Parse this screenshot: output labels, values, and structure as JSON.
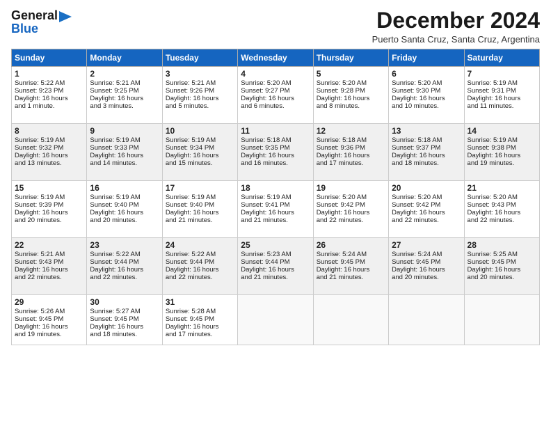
{
  "logo": {
    "line1": "General",
    "line2": "Blue"
  },
  "header": {
    "title": "December 2024",
    "subtitle": "Puerto Santa Cruz, Santa Cruz, Argentina"
  },
  "days_of_week": [
    "Sunday",
    "Monday",
    "Tuesday",
    "Wednesday",
    "Thursday",
    "Friday",
    "Saturday"
  ],
  "weeks": [
    [
      {
        "day": "1",
        "lines": [
          "Sunrise: 5:22 AM",
          "Sunset: 9:23 PM",
          "Daylight: 16 hours",
          "and 1 minute."
        ]
      },
      {
        "day": "2",
        "lines": [
          "Sunrise: 5:21 AM",
          "Sunset: 9:25 PM",
          "Daylight: 16 hours",
          "and 3 minutes."
        ]
      },
      {
        "day": "3",
        "lines": [
          "Sunrise: 5:21 AM",
          "Sunset: 9:26 PM",
          "Daylight: 16 hours",
          "and 5 minutes."
        ]
      },
      {
        "day": "4",
        "lines": [
          "Sunrise: 5:20 AM",
          "Sunset: 9:27 PM",
          "Daylight: 16 hours",
          "and 6 minutes."
        ]
      },
      {
        "day": "5",
        "lines": [
          "Sunrise: 5:20 AM",
          "Sunset: 9:28 PM",
          "Daylight: 16 hours",
          "and 8 minutes."
        ]
      },
      {
        "day": "6",
        "lines": [
          "Sunrise: 5:20 AM",
          "Sunset: 9:30 PM",
          "Daylight: 16 hours",
          "and 10 minutes."
        ]
      },
      {
        "day": "7",
        "lines": [
          "Sunrise: 5:19 AM",
          "Sunset: 9:31 PM",
          "Daylight: 16 hours",
          "and 11 minutes."
        ]
      }
    ],
    [
      {
        "day": "8",
        "lines": [
          "Sunrise: 5:19 AM",
          "Sunset: 9:32 PM",
          "Daylight: 16 hours",
          "and 13 minutes."
        ]
      },
      {
        "day": "9",
        "lines": [
          "Sunrise: 5:19 AM",
          "Sunset: 9:33 PM",
          "Daylight: 16 hours",
          "and 14 minutes."
        ]
      },
      {
        "day": "10",
        "lines": [
          "Sunrise: 5:19 AM",
          "Sunset: 9:34 PM",
          "Daylight: 16 hours",
          "and 15 minutes."
        ]
      },
      {
        "day": "11",
        "lines": [
          "Sunrise: 5:18 AM",
          "Sunset: 9:35 PM",
          "Daylight: 16 hours",
          "and 16 minutes."
        ]
      },
      {
        "day": "12",
        "lines": [
          "Sunrise: 5:18 AM",
          "Sunset: 9:36 PM",
          "Daylight: 16 hours",
          "and 17 minutes."
        ]
      },
      {
        "day": "13",
        "lines": [
          "Sunrise: 5:18 AM",
          "Sunset: 9:37 PM",
          "Daylight: 16 hours",
          "and 18 minutes."
        ]
      },
      {
        "day": "14",
        "lines": [
          "Sunrise: 5:19 AM",
          "Sunset: 9:38 PM",
          "Daylight: 16 hours",
          "and 19 minutes."
        ]
      }
    ],
    [
      {
        "day": "15",
        "lines": [
          "Sunrise: 5:19 AM",
          "Sunset: 9:39 PM",
          "Daylight: 16 hours",
          "and 20 minutes."
        ]
      },
      {
        "day": "16",
        "lines": [
          "Sunrise: 5:19 AM",
          "Sunset: 9:40 PM",
          "Daylight: 16 hours",
          "and 20 minutes."
        ]
      },
      {
        "day": "17",
        "lines": [
          "Sunrise: 5:19 AM",
          "Sunset: 9:40 PM",
          "Daylight: 16 hours",
          "and 21 minutes."
        ]
      },
      {
        "day": "18",
        "lines": [
          "Sunrise: 5:19 AM",
          "Sunset: 9:41 PM",
          "Daylight: 16 hours",
          "and 21 minutes."
        ]
      },
      {
        "day": "19",
        "lines": [
          "Sunrise: 5:20 AM",
          "Sunset: 9:42 PM",
          "Daylight: 16 hours",
          "and 22 minutes."
        ]
      },
      {
        "day": "20",
        "lines": [
          "Sunrise: 5:20 AM",
          "Sunset: 9:42 PM",
          "Daylight: 16 hours",
          "and 22 minutes."
        ]
      },
      {
        "day": "21",
        "lines": [
          "Sunrise: 5:20 AM",
          "Sunset: 9:43 PM",
          "Daylight: 16 hours",
          "and 22 minutes."
        ]
      }
    ],
    [
      {
        "day": "22",
        "lines": [
          "Sunrise: 5:21 AM",
          "Sunset: 9:43 PM",
          "Daylight: 16 hours",
          "and 22 minutes."
        ]
      },
      {
        "day": "23",
        "lines": [
          "Sunrise: 5:22 AM",
          "Sunset: 9:44 PM",
          "Daylight: 16 hours",
          "and 22 minutes."
        ]
      },
      {
        "day": "24",
        "lines": [
          "Sunrise: 5:22 AM",
          "Sunset: 9:44 PM",
          "Daylight: 16 hours",
          "and 22 minutes."
        ]
      },
      {
        "day": "25",
        "lines": [
          "Sunrise: 5:23 AM",
          "Sunset: 9:44 PM",
          "Daylight: 16 hours",
          "and 21 minutes."
        ]
      },
      {
        "day": "26",
        "lines": [
          "Sunrise: 5:24 AM",
          "Sunset: 9:45 PM",
          "Daylight: 16 hours",
          "and 21 minutes."
        ]
      },
      {
        "day": "27",
        "lines": [
          "Sunrise: 5:24 AM",
          "Sunset: 9:45 PM",
          "Daylight: 16 hours",
          "and 20 minutes."
        ]
      },
      {
        "day": "28",
        "lines": [
          "Sunrise: 5:25 AM",
          "Sunset: 9:45 PM",
          "Daylight: 16 hours",
          "and 20 minutes."
        ]
      }
    ],
    [
      {
        "day": "29",
        "lines": [
          "Sunrise: 5:26 AM",
          "Sunset: 9:45 PM",
          "Daylight: 16 hours",
          "and 19 minutes."
        ]
      },
      {
        "day": "30",
        "lines": [
          "Sunrise: 5:27 AM",
          "Sunset: 9:45 PM",
          "Daylight: 16 hours",
          "and 18 minutes."
        ]
      },
      {
        "day": "31",
        "lines": [
          "Sunrise: 5:28 AM",
          "Sunset: 9:45 PM",
          "Daylight: 16 hours",
          "and 17 minutes."
        ]
      },
      null,
      null,
      null,
      null
    ]
  ]
}
